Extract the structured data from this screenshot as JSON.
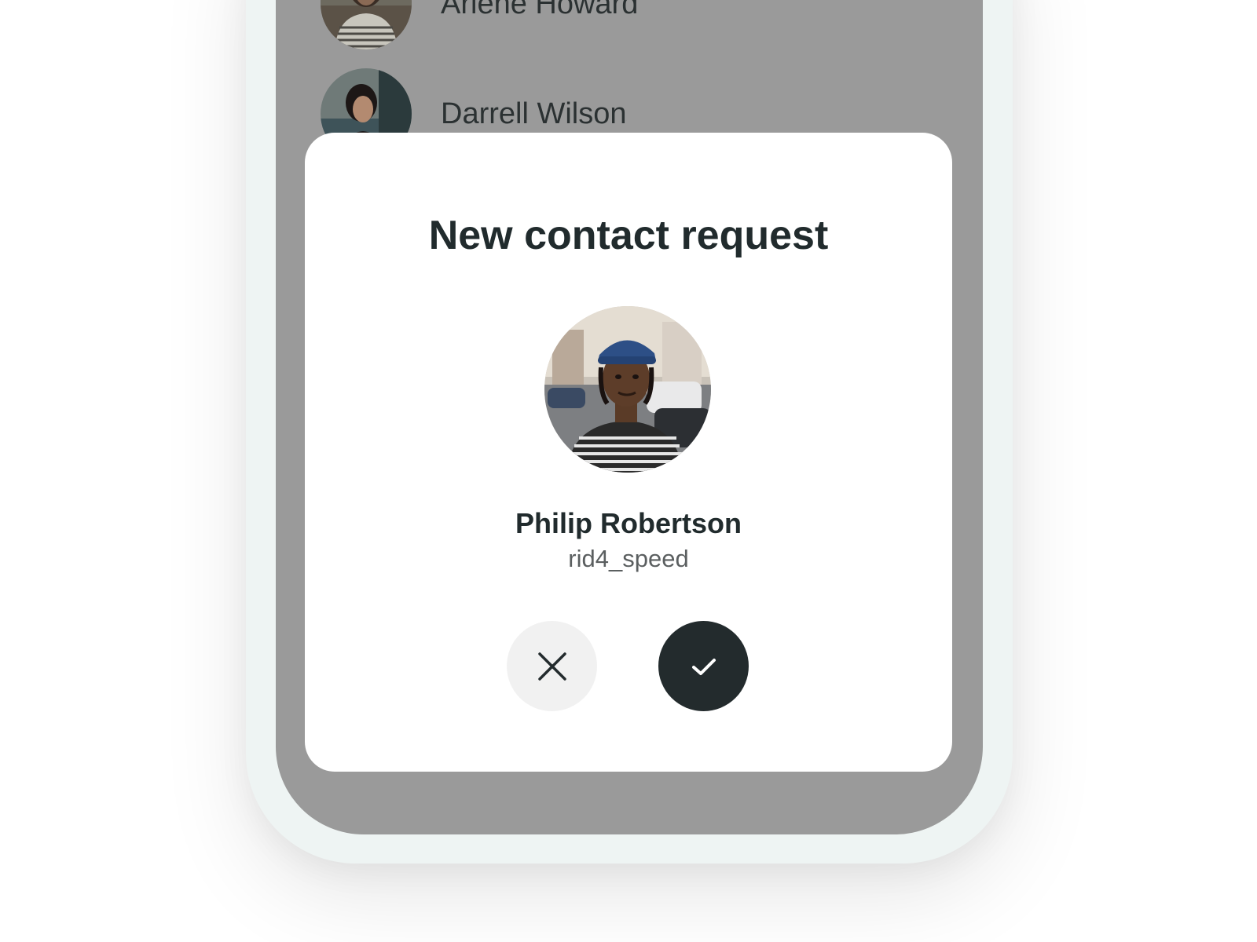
{
  "contacts": [
    {
      "name": "Arlene Howard",
      "avatar": "photo-woman-striped-shirt"
    },
    {
      "name": "Darrell Wilson",
      "avatar": "photo-woman-dark-hair"
    }
  ],
  "modal": {
    "title": "New contact request",
    "avatar": "photo-man-blue-cap-street",
    "name": "Philip Robertson",
    "username": "rid4_speed",
    "decline_icon": "close-icon",
    "accept_icon": "checkmark-icon"
  },
  "colors": {
    "overlay": "#9a9a9a",
    "frame": "#eef4f3",
    "modal_background": "#ffffff",
    "title_text": "#212b2d",
    "secondary_text": "#5b5f60",
    "decline_button": "#f1f1f1",
    "accept_button": "#232b2d",
    "accept_icon": "#ffffff"
  }
}
